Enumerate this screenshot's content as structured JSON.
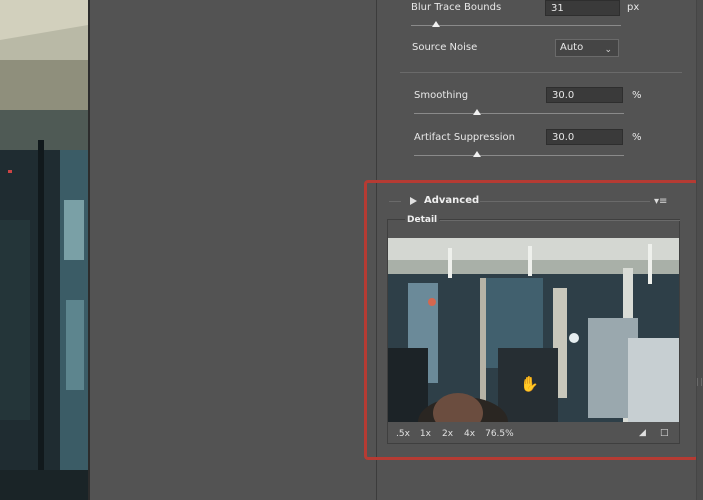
{
  "settings": {
    "blur_trace_bounds": {
      "label": "Blur Trace Bounds",
      "value": "31",
      "unit": "px",
      "slider_fraction": 0.12
    },
    "source_noise": {
      "label": "Source Noise",
      "value": "Auto"
    },
    "smoothing": {
      "label": "Smoothing",
      "value": "30.0",
      "unit": "%",
      "slider_fraction": 0.3
    },
    "artifact_suppression": {
      "label": "Artifact Suppression",
      "value": "30.0",
      "unit": "%",
      "slider_fraction": 0.3
    }
  },
  "advanced": {
    "title": "Advanced",
    "menu_icon": "flyout-menu-icon"
  },
  "detail": {
    "title": "Detail",
    "zoom_levels": [
      ".5x",
      "1x",
      "2x",
      "4x"
    ],
    "zoom_readout": "76.5%"
  },
  "colors": {
    "panel_bg": "#535353",
    "highlight": "#b53b33",
    "field_bg": "#3a3a3a"
  }
}
